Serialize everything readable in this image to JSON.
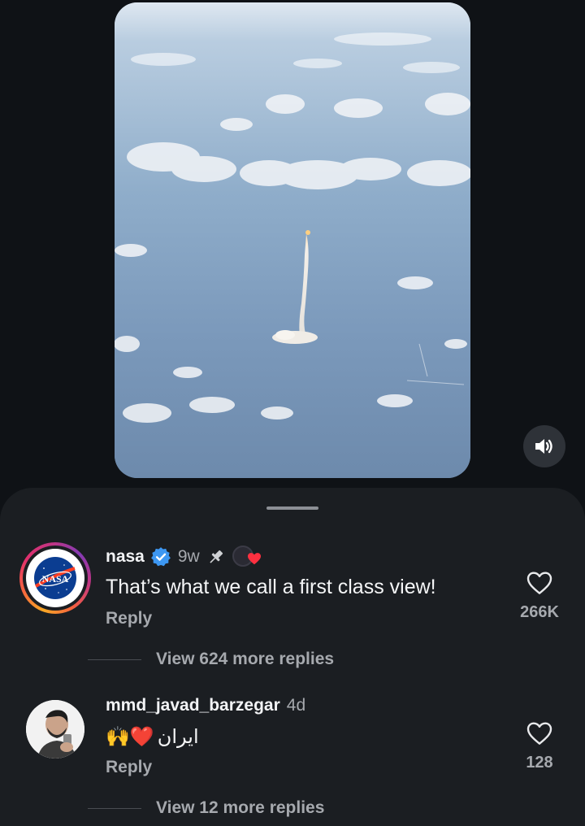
{
  "video": {
    "description_icon": "rocket-launch-video"
  },
  "sound_button": {
    "icon": "speaker-icon"
  },
  "comments": [
    {
      "username": "nasa",
      "time": "9w",
      "verified": true,
      "pinned": true,
      "text": "That’s what we call a first class view!",
      "reply_label": "Reply",
      "likes": "266K",
      "view_more": "View 624 more replies"
    },
    {
      "username": "mmd_javad_barzegar",
      "time": "4d",
      "text": "ایران",
      "emoji": "🙌❤️",
      "reply_label": "Reply",
      "likes": "128",
      "view_more": "View 12 more replies"
    }
  ]
}
